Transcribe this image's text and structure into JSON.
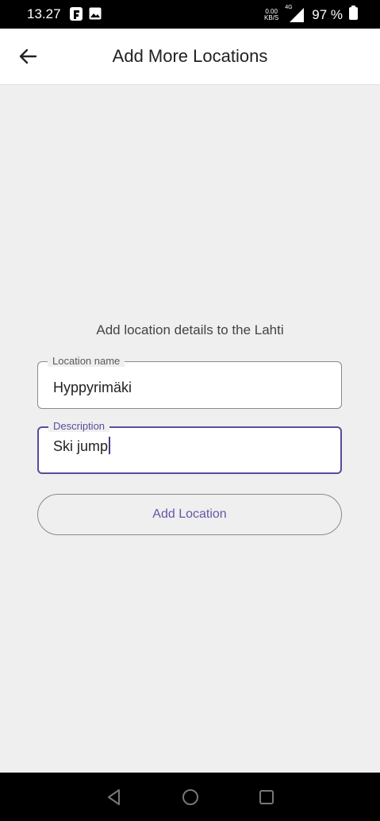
{
  "status_bar": {
    "time": "13.27",
    "net_speed_value": "0.00",
    "net_speed_unit": "KB/S",
    "network_type": "4G",
    "battery_percent": "97 %"
  },
  "header": {
    "title": "Add More Locations"
  },
  "form": {
    "prompt": "Add location details to the Lahti",
    "location_name": {
      "label": "Location name",
      "value": "Hyppyrimäki"
    },
    "description": {
      "label": "Description",
      "value": "Ski jump"
    },
    "submit_label": "Add Location"
  },
  "colors": {
    "accent": "#5c4a9b",
    "background": "#efefef"
  }
}
